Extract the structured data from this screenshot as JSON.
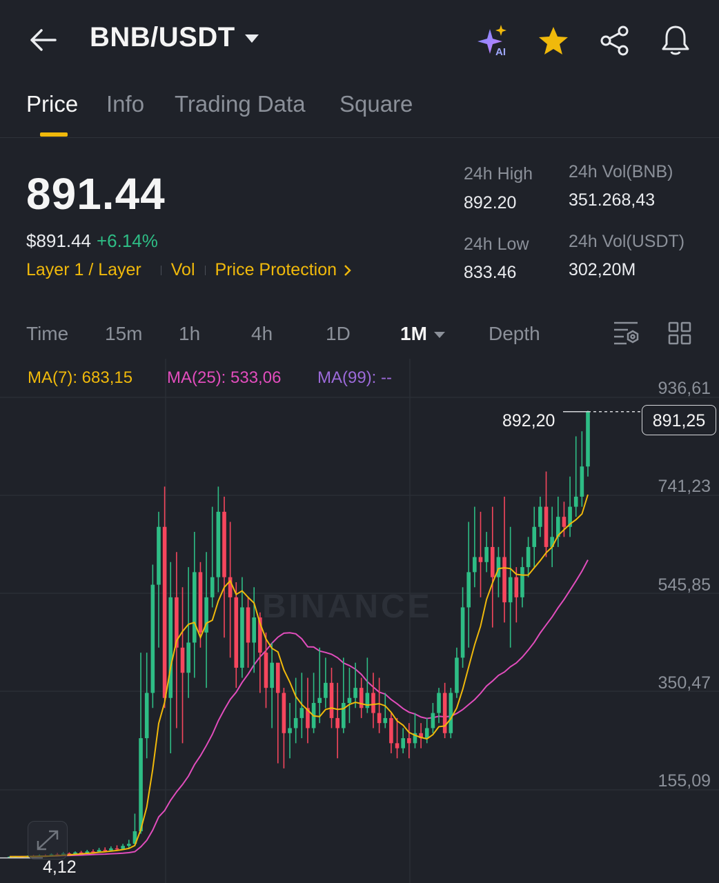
{
  "header": {
    "title": "BNB/USDT",
    "ai_badge": "AI"
  },
  "tabs": [
    "Price",
    "Info",
    "Trading Data",
    "Square"
  ],
  "summary": {
    "last_price": "891.44",
    "usd_price": "$891.44",
    "change_pct": "+6.14%",
    "tags": [
      "Layer 1 / Layer",
      "Vol",
      "Price Protection"
    ],
    "stats": [
      {
        "label": "24h High",
        "value": "892.20"
      },
      {
        "label": "24h Vol(BNB)",
        "value": "351.268,43"
      },
      {
        "label": "24h Low",
        "value": "833.46"
      },
      {
        "label": "24h Vol(USDT)",
        "value": "302,20M"
      }
    ]
  },
  "intervals": [
    "Time",
    "15m",
    "1h",
    "4h",
    "1D",
    "1M",
    "Depth"
  ],
  "active_interval": "1M",
  "indicators": {
    "ma7": "MA(7): 683,15",
    "ma25": "MA(25): 533,06",
    "ma99": "MA(99): --"
  },
  "colors": {
    "up": "#2ebd85",
    "down": "#f6465d",
    "accent": "#f0b90b",
    "ma7": "#f0b90b",
    "ma25": "#e24dbd",
    "ma99": "#9c6ad9"
  },
  "watermark": "BINANCE",
  "chart_data": {
    "type": "candlestick",
    "y_axis_labels": [
      "936,61",
      "741,23",
      "545,85",
      "350,47",
      "155,09"
    ],
    "ylim": [
      -10,
      995
    ],
    "last_price_label": "891,25",
    "high_label": "892,20",
    "low_label": "4,12",
    "candles": [
      [
        4,
        4.5,
        2,
        5
      ],
      [
        4.5,
        5,
        3,
        6
      ],
      [
        5,
        4,
        3,
        6
      ],
      [
        4,
        6,
        3,
        7
      ],
      [
        6,
        5,
        4,
        8
      ],
      [
        5,
        7,
        4,
        9
      ],
      [
        7,
        6,
        5,
        9
      ],
      [
        6,
        9,
        5,
        11
      ],
      [
        9,
        8,
        6,
        12
      ],
      [
        8,
        11,
        7,
        14
      ],
      [
        11,
        10,
        8,
        13
      ],
      [
        10,
        13,
        9,
        15
      ],
      [
        13,
        12,
        10,
        16
      ],
      [
        12,
        15,
        11,
        18
      ],
      [
        15,
        14,
        12,
        19
      ],
      [
        14,
        18,
        13,
        22
      ],
      [
        18,
        17,
        15,
        23
      ],
      [
        17,
        21,
        16,
        25
      ],
      [
        21,
        20,
        18,
        27
      ],
      [
        20,
        26,
        19,
        30
      ],
      [
        26,
        30,
        22,
        38
      ],
      [
        30,
        55,
        28,
        90
      ],
      [
        55,
        240,
        50,
        410
      ],
      [
        240,
        330,
        200,
        410
      ],
      [
        330,
        545,
        300,
        585
      ],
      [
        545,
        660,
        420,
        690
      ],
      [
        660,
        320,
        300,
        740
      ],
      [
        320,
        520,
        210,
        590
      ],
      [
        520,
        420,
        260,
        610
      ],
      [
        420,
        370,
        230,
        540
      ],
      [
        370,
        430,
        320,
        580
      ],
      [
        430,
        570,
        360,
        650
      ],
      [
        570,
        450,
        420,
        590
      ],
      [
        450,
        520,
        340,
        610
      ],
      [
        520,
        560,
        500,
        700
      ],
      [
        560,
        690,
        530,
        740
      ],
      [
        690,
        560,
        440,
        720
      ],
      [
        560,
        520,
        400,
        670
      ],
      [
        520,
        380,
        340,
        550
      ],
      [
        380,
        500,
        360,
        560
      ],
      [
        500,
        430,
        380,
        520
      ],
      [
        430,
        480,
        370,
        540
      ],
      [
        480,
        410,
        330,
        490
      ],
      [
        410,
        340,
        300,
        450
      ],
      [
        340,
        390,
        260,
        430
      ],
      [
        390,
        330,
        190,
        360
      ],
      [
        330,
        250,
        180,
        340
      ],
      [
        250,
        260,
        200,
        310
      ],
      [
        260,
        280,
        230,
        360
      ],
      [
        280,
        300,
        240,
        370
      ],
      [
        300,
        260,
        230,
        360
      ],
      [
        260,
        310,
        250,
        370
      ],
      [
        310,
        320,
        270,
        420
      ],
      [
        320,
        350,
        300,
        400
      ],
      [
        350,
        280,
        260,
        380
      ],
      [
        280,
        260,
        200,
        350
      ],
      [
        260,
        310,
        250,
        400
      ],
      [
        310,
        320,
        270,
        380
      ],
      [
        320,
        340,
        300,
        390
      ],
      [
        340,
        300,
        280,
        360
      ],
      [
        300,
        330,
        290,
        400
      ],
      [
        330,
        290,
        260,
        370
      ],
      [
        290,
        270,
        250,
        360
      ],
      [
        270,
        280,
        260,
        330
      ],
      [
        280,
        230,
        210,
        290
      ],
      [
        230,
        220,
        200,
        280
      ],
      [
        220,
        240,
        210,
        260
      ],
      [
        240,
        230,
        200,
        270
      ],
      [
        230,
        250,
        220,
        290
      ],
      [
        250,
        240,
        220,
        270
      ],
      [
        240,
        260,
        230,
        280
      ],
      [
        260,
        290,
        250,
        310
      ],
      [
        290,
        330,
        270,
        340
      ],
      [
        330,
        250,
        240,
        350
      ],
      [
        250,
        330,
        240,
        340
      ],
      [
        330,
        400,
        320,
        420
      ],
      [
        400,
        500,
        380,
        540
      ],
      [
        500,
        570,
        420,
        670
      ],
      [
        570,
        600,
        540,
        700
      ],
      [
        600,
        590,
        520,
        690
      ],
      [
        590,
        620,
        570,
        650
      ],
      [
        620,
        560,
        460,
        700
      ],
      [
        560,
        600,
        520,
        620
      ],
      [
        600,
        510,
        470,
        720
      ],
      [
        510,
        560,
        420,
        660
      ],
      [
        560,
        520,
        470,
        580
      ],
      [
        520,
        580,
        500,
        600
      ],
      [
        580,
        620,
        560,
        640
      ],
      [
        620,
        660,
        580,
        700
      ],
      [
        660,
        700,
        640,
        720
      ],
      [
        700,
        620,
        600,
        770
      ],
      [
        620,
        640,
        580,
        700
      ],
      [
        640,
        680,
        620,
        720
      ],
      [
        680,
        660,
        640,
        710
      ],
      [
        660,
        700,
        640,
        760
      ],
      [
        700,
        720,
        680,
        840
      ],
      [
        720,
        780,
        700,
        850
      ],
      [
        780,
        889,
        760,
        891
      ]
    ]
  }
}
